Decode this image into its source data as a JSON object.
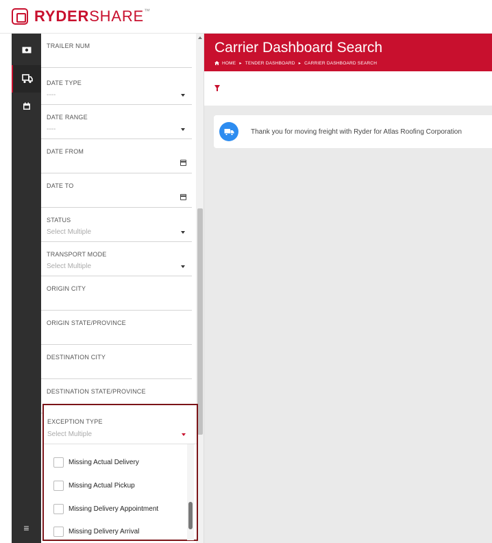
{
  "brand": {
    "name_bold": "RYDER",
    "name_regular": "SHARE",
    "trademark": "™"
  },
  "rail": {
    "items": [
      {
        "icon": "money-icon"
      },
      {
        "icon": "truck-icon",
        "active": true
      },
      {
        "icon": "calendar-icon"
      }
    ],
    "menu_icon": "≡"
  },
  "filters": {
    "trailer_num": {
      "label": "TRAILER NUM"
    },
    "date_type": {
      "label": "DATE TYPE",
      "value": "----"
    },
    "date_range": {
      "label": "DATE RANGE",
      "value": "----"
    },
    "date_from": {
      "label": "DATE FROM"
    },
    "date_to": {
      "label": "DATE TO"
    },
    "status": {
      "label": "STATUS",
      "value": "Select Multiple"
    },
    "transport_mode": {
      "label": "TRANSPORT MODE",
      "value": "Select Multiple"
    },
    "origin_city": {
      "label": "ORIGIN CITY"
    },
    "origin_state": {
      "label": "ORIGIN STATE/PROVINCE"
    },
    "destination_city": {
      "label": "DESTINATION CITY"
    },
    "destination_state": {
      "label": "DESTINATION STATE/PROVINCE"
    },
    "exception_type": {
      "label": "EXCEPTION TYPE",
      "value": "Select Multiple",
      "options": [
        "Missing Actual Delivery",
        "Missing Actual Pickup",
        "Missing Delivery Appointment",
        "Missing Delivery Arrival"
      ]
    }
  },
  "main": {
    "title": "Carrier Dashboard Search",
    "breadcrumb": [
      "HOME",
      "TENDER DASHBOARD",
      "CARRIER DASHBOARD SEARCH"
    ],
    "notice": "Thank you for moving freight with Ryder for Atlas Roofing Corporation"
  },
  "colors": {
    "brand_red": "#c8102e",
    "rail_dark": "#2f2f2f",
    "highlight_border": "#7b1418",
    "info_blue": "#2d8cf0"
  }
}
